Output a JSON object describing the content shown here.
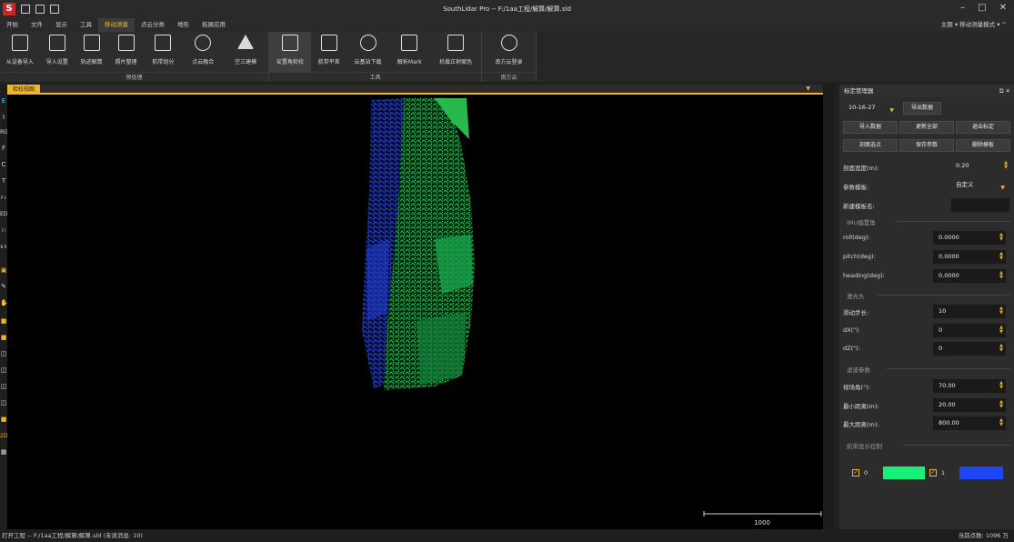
{
  "app": {
    "title": "SouthLidar Pro -- F:/1aa工程/解算/解算.sld"
  },
  "menu": {
    "items": [
      "开始",
      "文件",
      "显示",
      "工具",
      "移动测量",
      "点云分类",
      "地形",
      "拓展应用"
    ],
    "right": "主题 ▾  移动测量模式 ▾  ^"
  },
  "ribbon": {
    "groups": [
      {
        "label": "预处理",
        "buttons": [
          "从设备导入",
          "导入设置",
          "轨迹解算",
          "照片整理",
          "航带划分",
          "点云融合",
          "空三建模"
        ]
      },
      {
        "label": "工具",
        "buttons": [
          "安置角检校",
          "航带平差",
          "云基站下载",
          "解析Mark",
          "机载正射赋色"
        ]
      },
      {
        "label": "南方云",
        "buttons": [
          "南方云登录"
        ]
      }
    ]
  },
  "view": {
    "tab": "检校视图",
    "scale_label": "1000",
    "left_toolbar": [
      "E",
      "I",
      "RGB",
      "F",
      "C",
      "T",
      "P L",
      "EDL",
      "F I",
      "N R"
    ],
    "bottom_tool": "2D"
  },
  "panel": {
    "title": "标定管理器",
    "select_value": "10-16-27",
    "btn_export": "导出数据",
    "btn_import": "导入数据",
    "btn_update": "更新全部",
    "btn_exit": "退出标定",
    "btn_profile": "剖面选点",
    "btn_save": "保存参数",
    "btn_delete": "删除模板",
    "profile_width_label": "剖面宽度(m):",
    "profile_width_value": "0.20",
    "template_label": "参数模板:",
    "template_value": "自定义",
    "new_template_label": "新建模板名:",
    "new_template_value": "",
    "imu_section": "IMU偏置角",
    "roll_label": "roll(deg):",
    "roll_value": "0.0000",
    "pitch_label": "pitch(deg):",
    "pitch_value": "0.0000",
    "heading_label": "heading(deg):",
    "heading_value": "0.0000",
    "laser_section": "激光头",
    "step_label": "滑动步长:",
    "step_value": "10",
    "dx_label": "dX(\"):",
    "dx_value": "0",
    "dz_label": "dZ(\"):",
    "dz_value": "0",
    "filter_section": "滤波参数",
    "fov_label": "视场角(°):",
    "fov_value": "70.00",
    "min_label": "最小距离(m):",
    "min_value": "20.00",
    "max_label": "最大距离(m):",
    "max_value": "800.00",
    "strip_section": "航带显示控制",
    "strip0": "0",
    "strip1": "1",
    "color0": "#19f07a",
    "color1": "#1f46f5"
  },
  "status": {
    "left": "打开工程 -- F:/1aa工程/解算/解算.sld (未读消息: 10)",
    "right": "当前点数: 1096 万"
  }
}
